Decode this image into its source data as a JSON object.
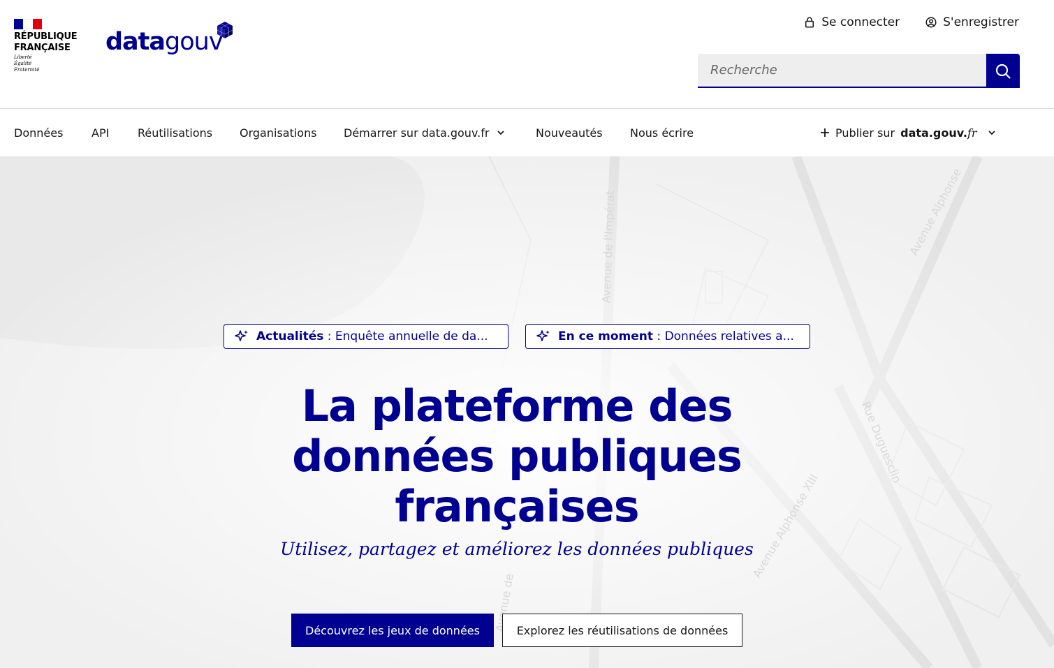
{
  "header": {
    "republic_line1": "RÉPUBLIQUE",
    "republic_line2": "FRANÇAISE",
    "motto1": "Liberté",
    "motto2": "Égalité",
    "motto3": "Fraternité",
    "logo_bold": "data",
    "logo_light": "gouv",
    "login_label": "Se connecter",
    "register_label": "S'enregistrer",
    "search_placeholder": "Recherche"
  },
  "nav": {
    "items": [
      {
        "label": "Données"
      },
      {
        "label": "API"
      },
      {
        "label": "Réutilisations"
      },
      {
        "label": "Organisations"
      },
      {
        "label": "Démarrer sur data.gouv.fr"
      },
      {
        "label": "Nouveautés"
      },
      {
        "label": "Nous écrire"
      }
    ],
    "publish_prefix": "Publier sur",
    "publish_brand": "data.gouv.",
    "publish_tld": "fr"
  },
  "hero": {
    "tag1_bold": "Actualités",
    "tag1_text": " : Enquête annuelle de da...",
    "tag2_bold": "En ce moment",
    "tag2_text": " : Données relatives a...",
    "title_line1": "La plateforme des",
    "title_line2": "données publiques",
    "title_line3": "françaises",
    "subtitle": "Utilisez, partagez et améliorez les données publiques",
    "primary_button": "Découvrez les jeux de données",
    "secondary_button": "Explorez les réutilisations de données",
    "map_labels": [
      "Avenue de l'Impérat",
      "Avenue Alphonse",
      "Rue Duguesclin",
      "Avenue Alphonse XIII",
      "Avenue de"
    ]
  },
  "colors": {
    "primary": "#000091",
    "flag_red": "#e1000f"
  }
}
